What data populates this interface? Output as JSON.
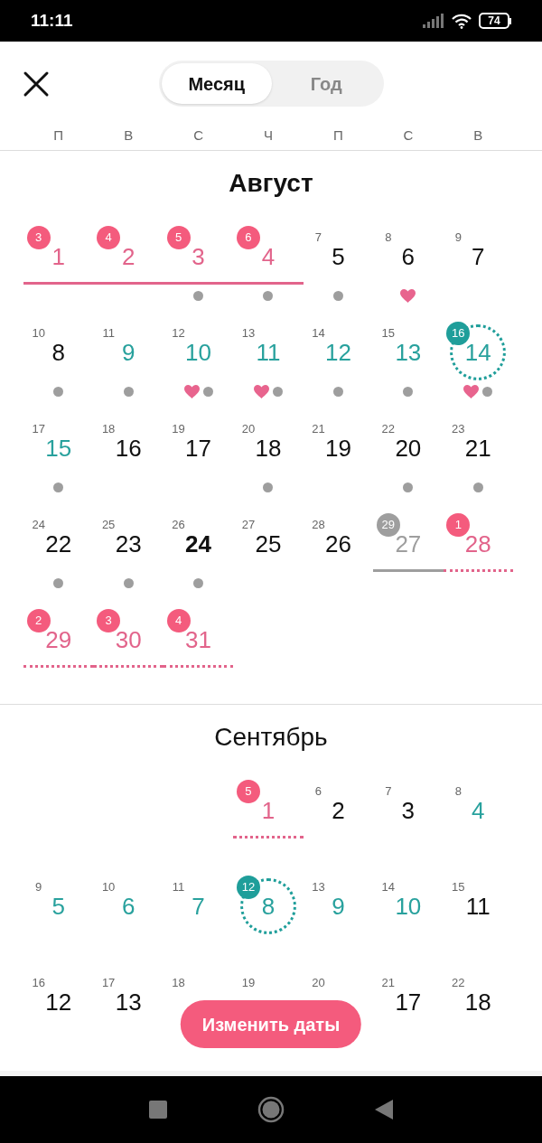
{
  "status_bar": {
    "time": "11:11",
    "battery": "74"
  },
  "view_tabs": [
    {
      "label": "Месяц",
      "selected": true
    },
    {
      "label": "Год",
      "selected": false
    }
  ],
  "weekdays": [
    "П",
    "В",
    "С",
    "Ч",
    "П",
    "С",
    "В"
  ],
  "months": [
    {
      "title": "Август",
      "weeks": [
        [
          {
            "day": "1",
            "cycle": "3",
            "kind": "period",
            "badge": true,
            "underline": {
              "kind": "solid"
            },
            "dot": false,
            "heart": false
          },
          {
            "day": "2",
            "cycle": "4",
            "kind": "period",
            "badge": true,
            "underline": {
              "kind": "solid"
            },
            "dot": false,
            "heart": false
          },
          {
            "day": "3",
            "cycle": "5",
            "kind": "period",
            "badge": true,
            "underline": {
              "kind": "solid"
            },
            "dot": true,
            "heart": false
          },
          {
            "day": "4",
            "cycle": "6",
            "kind": "period",
            "badge": true,
            "underline": {
              "kind": "solid"
            },
            "dot": true,
            "heart": false
          },
          {
            "day": "5",
            "cycle": "7",
            "kind": "normal",
            "badge": false,
            "dot": true,
            "heart": false
          },
          {
            "day": "6",
            "cycle": "8",
            "kind": "normal",
            "badge": false,
            "dot": false,
            "heart": true
          },
          {
            "day": "7",
            "cycle": "9",
            "kind": "normal",
            "badge": false,
            "dot": false,
            "heart": false
          }
        ],
        [
          {
            "day": "8",
            "cycle": "10",
            "kind": "normal",
            "badge": false,
            "dot": true,
            "heart": false
          },
          {
            "day": "9",
            "cycle": "11",
            "kind": "fertile",
            "badge": false,
            "dot": true,
            "heart": false
          },
          {
            "day": "10",
            "cycle": "12",
            "kind": "fertile",
            "badge": false,
            "dot": true,
            "heart": true
          },
          {
            "day": "11",
            "cycle": "13",
            "kind": "fertile",
            "badge": false,
            "dot": true,
            "heart": true
          },
          {
            "day": "12",
            "cycle": "14",
            "kind": "fertile",
            "badge": false,
            "dot": true,
            "heart": false
          },
          {
            "day": "13",
            "cycle": "15",
            "kind": "fertile",
            "badge": false,
            "dot": true,
            "heart": false
          },
          {
            "day": "14",
            "cycle": "16",
            "kind": "ovulation",
            "badge": true,
            "dot": true,
            "heart": true
          }
        ],
        [
          {
            "day": "15",
            "cycle": "17",
            "kind": "fertile",
            "badge": false,
            "dot": true,
            "heart": false
          },
          {
            "day": "16",
            "cycle": "18",
            "kind": "normal",
            "badge": false,
            "dot": false,
            "heart": false
          },
          {
            "day": "17",
            "cycle": "19",
            "kind": "normal",
            "badge": false,
            "dot": false,
            "heart": false
          },
          {
            "day": "18",
            "cycle": "20",
            "kind": "normal",
            "badge": false,
            "dot": true,
            "heart": false
          },
          {
            "day": "19",
            "cycle": "21",
            "kind": "normal",
            "badge": false,
            "dot": false,
            "heart": false
          },
          {
            "day": "20",
            "cycle": "22",
            "kind": "normal",
            "badge": false,
            "dot": true,
            "heart": false
          },
          {
            "day": "21",
            "cycle": "23",
            "kind": "normal",
            "badge": false,
            "dot": true,
            "heart": false
          }
        ],
        [
          {
            "day": "22",
            "cycle": "24",
            "kind": "normal",
            "badge": false,
            "dot": true,
            "heart": false
          },
          {
            "day": "23",
            "cycle": "25",
            "kind": "normal",
            "badge": false,
            "dot": true,
            "heart": false
          },
          {
            "day": "24",
            "cycle": "26",
            "kind": "today",
            "badge": false,
            "dot": true,
            "heart": false
          },
          {
            "day": "25",
            "cycle": "27",
            "kind": "normal",
            "badge": false,
            "dot": false,
            "heart": false
          },
          {
            "day": "26",
            "cycle": "28",
            "kind": "normal",
            "badge": false,
            "dot": false,
            "heart": false
          },
          {
            "day": "27",
            "cycle": "29",
            "kind": "late",
            "badge": true,
            "underline": {
              "kind": "solid"
            },
            "dot": false,
            "heart": false
          },
          {
            "day": "28",
            "cycle": "1",
            "kind": "period",
            "badge": true,
            "underline": {
              "kind": "dotted"
            },
            "dot": false,
            "heart": false
          }
        ],
        [
          {
            "day": "29",
            "cycle": "2",
            "kind": "period",
            "badge": true,
            "underline": {
              "kind": "dotted"
            },
            "dot": false,
            "heart": false
          },
          {
            "day": "30",
            "cycle": "3",
            "kind": "period",
            "badge": true,
            "underline": {
              "kind": "dotted"
            },
            "dot": false,
            "heart": false
          },
          {
            "day": "31",
            "cycle": "4",
            "kind": "period",
            "badge": true,
            "underline": {
              "kind": "dotted"
            },
            "dot": false,
            "heart": false
          },
          {
            "kind": "blank"
          },
          {
            "kind": "blank"
          },
          {
            "kind": "blank"
          },
          {
            "kind": "blank"
          }
        ]
      ]
    },
    {
      "title": "Сентябрь",
      "weeks": [
        [
          {
            "kind": "blank"
          },
          {
            "kind": "blank"
          },
          {
            "kind": "blank"
          },
          {
            "day": "1",
            "cycle": "5",
            "kind": "period",
            "badge": true,
            "underline": {
              "kind": "dotted"
            }
          },
          {
            "day": "2",
            "cycle": "6",
            "kind": "normal",
            "badge": false
          },
          {
            "day": "3",
            "cycle": "7",
            "kind": "normal",
            "badge": false
          },
          {
            "day": "4",
            "cycle": "8",
            "kind": "fertile",
            "badge": false
          }
        ],
        [
          {
            "day": "5",
            "cycle": "9",
            "kind": "fertile",
            "badge": false
          },
          {
            "day": "6",
            "cycle": "10",
            "kind": "fertile",
            "badge": false
          },
          {
            "day": "7",
            "cycle": "11",
            "kind": "fertile",
            "badge": false
          },
          {
            "day": "8",
            "cycle": "12",
            "kind": "ovulation",
            "badge": true
          },
          {
            "day": "9",
            "cycle": "13",
            "kind": "fertile",
            "badge": false
          },
          {
            "day": "10",
            "cycle": "14",
            "kind": "fertile",
            "badge": false
          },
          {
            "day": "11",
            "cycle": "15",
            "kind": "normal",
            "badge": false
          }
        ],
        [
          {
            "day": "12",
            "cycle": "16",
            "kind": "normal",
            "badge": false
          },
          {
            "day": "13",
            "cycle": "17",
            "kind": "normal",
            "badge": false
          },
          {
            "cycle": "18",
            "kind": "normal",
            "badge": false
          },
          {
            "cycle": "19",
            "kind": "normal",
            "badge": false
          },
          {
            "cycle": "20",
            "kind": "normal",
            "badge": false
          },
          {
            "day": "17",
            "cycle": "21",
            "kind": "normal",
            "badge": false
          },
          {
            "day": "18",
            "cycle": "22",
            "kind": "normal",
            "badge": false
          }
        ]
      ]
    }
  ],
  "action_button": {
    "label": "Изменить даты"
  }
}
